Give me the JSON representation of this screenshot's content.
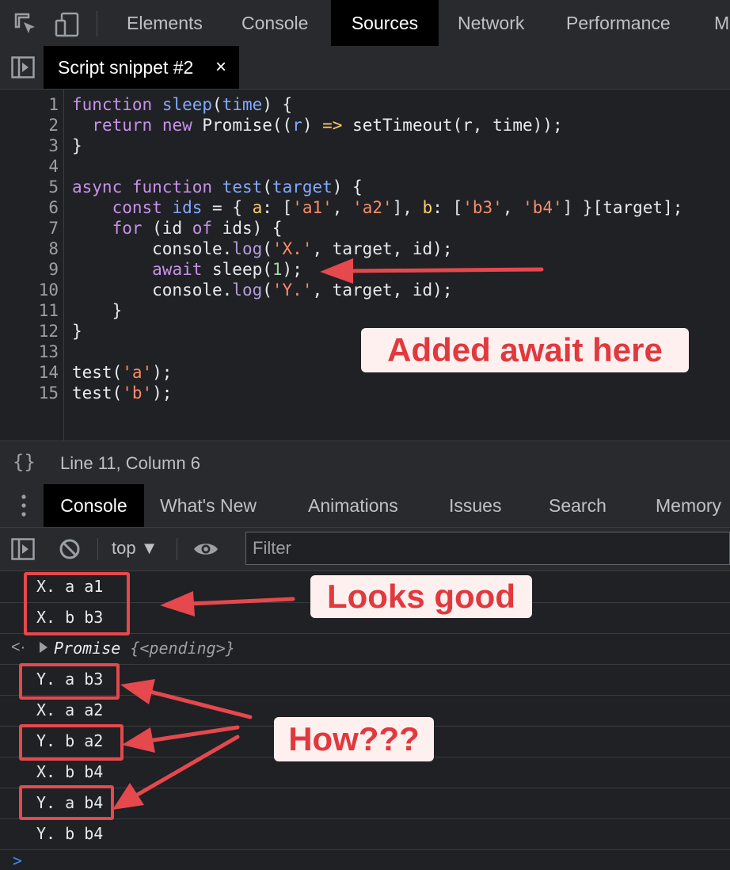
{
  "devtools_tabs": [
    "Elements",
    "Console",
    "Sources",
    "Network",
    "Performance",
    "M"
  ],
  "active_tab": "Sources",
  "file_tab": {
    "name": "Script snippet #2",
    "close": "×"
  },
  "code_lines": [
    {
      "n": "1"
    },
    {
      "n": "2"
    },
    {
      "n": "3"
    },
    {
      "n": "4"
    },
    {
      "n": "5"
    },
    {
      "n": "6"
    },
    {
      "n": "7"
    },
    {
      "n": "8"
    },
    {
      "n": "9"
    },
    {
      "n": "10"
    },
    {
      "n": "11"
    },
    {
      "n": "12"
    },
    {
      "n": "13"
    },
    {
      "n": "14"
    },
    {
      "n": "15"
    }
  ],
  "code_text": {
    "l1": "function sleep(time) {",
    "l2": "  return new Promise((r) => setTimeout(r, time));",
    "l3": "}",
    "l4": "",
    "l5": "async function test(target) {",
    "l6": "    const ids = { a: ['a1', 'a2'], b: ['b3', 'b4'] }[target];",
    "l7": "    for (id of ids) {",
    "l8": "        console.log('X.', target, id);",
    "l9": "        await sleep(1);",
    "l10": "        console.log('Y.', target, id);",
    "l11": "    }",
    "l12": "}",
    "l13": "",
    "l14": "test('a');",
    "l15": "test('b');"
  },
  "status": {
    "braces": "{}",
    "position": "Line 11, Column 6"
  },
  "drawer_tabs": [
    "Console",
    "What's New",
    "Animations",
    "Issues",
    "Search",
    "Memory"
  ],
  "console_toolbar": {
    "context": "top ▼",
    "filter_placeholder": "Filter"
  },
  "console_logs": [
    "X. a a1",
    "X. b b3",
    "Y. a b3",
    "X. a a2",
    "Y. b a2",
    "X. b b4",
    "Y. a b4",
    "Y. b b4"
  ],
  "promise_entry": {
    "caret": "<·",
    "label": "Promise",
    "state": "{<pending>}"
  },
  "prompt": ">",
  "annotations": {
    "editor_note": "Added await here",
    "good_note": "Looks good",
    "how_note": "How???"
  },
  "colors": {
    "annotation_red": "#e5484d",
    "annotation_bg": "#fff0f0"
  }
}
